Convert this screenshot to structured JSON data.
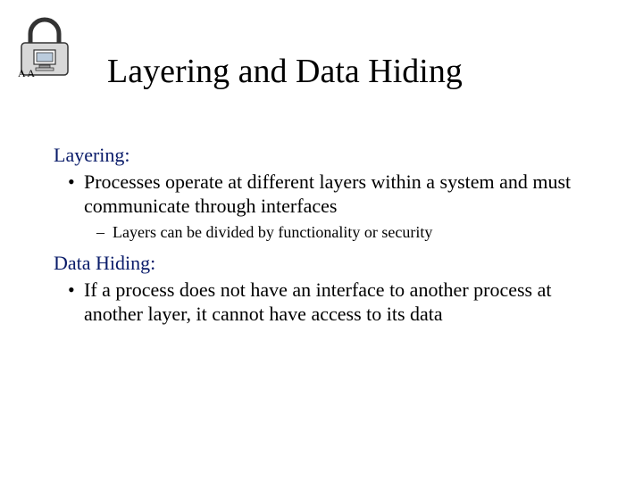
{
  "icon": {
    "name": "padlock-computer-logo"
  },
  "title": "Layering and Data Hiding",
  "section1": {
    "heading": "Layering:",
    "bullet": "Processes operate at different layers within a system and must communicate through interfaces",
    "sub": "Layers can be divided by functionality or security"
  },
  "section2": {
    "heading": "Data Hiding:",
    "bullet": "If a process does not have an interface to another process at another layer, it cannot have access to its data"
  },
  "colors": {
    "heading": "#0a1c6a",
    "body": "#000000"
  }
}
